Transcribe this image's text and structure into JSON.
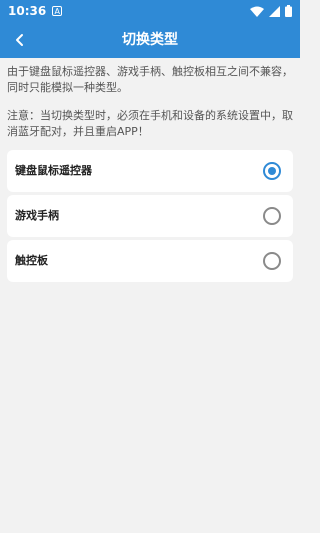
{
  "status_bar": {
    "time": "10:36",
    "a_badge": "A"
  },
  "app_bar": {
    "title": "切换类型",
    "back_icon": "chevron-left-icon"
  },
  "notes": {
    "compat": "由于键盘鼠标遥控器、游戏手柄、触控板相互之间不兼容，同时只能模拟一种类型。",
    "warning": "注意：当切换类型时，必须在手机和设备的系统设置中，取消蓝牙配对，并且重启APP！"
  },
  "options": [
    {
      "label": "键盘鼠标遥控器",
      "selected": true
    },
    {
      "label": "游戏手柄",
      "selected": false
    },
    {
      "label": "触控板",
      "selected": false
    }
  ],
  "colors": {
    "accent": "#2f8ad6",
    "background": "#f2f2f2"
  }
}
